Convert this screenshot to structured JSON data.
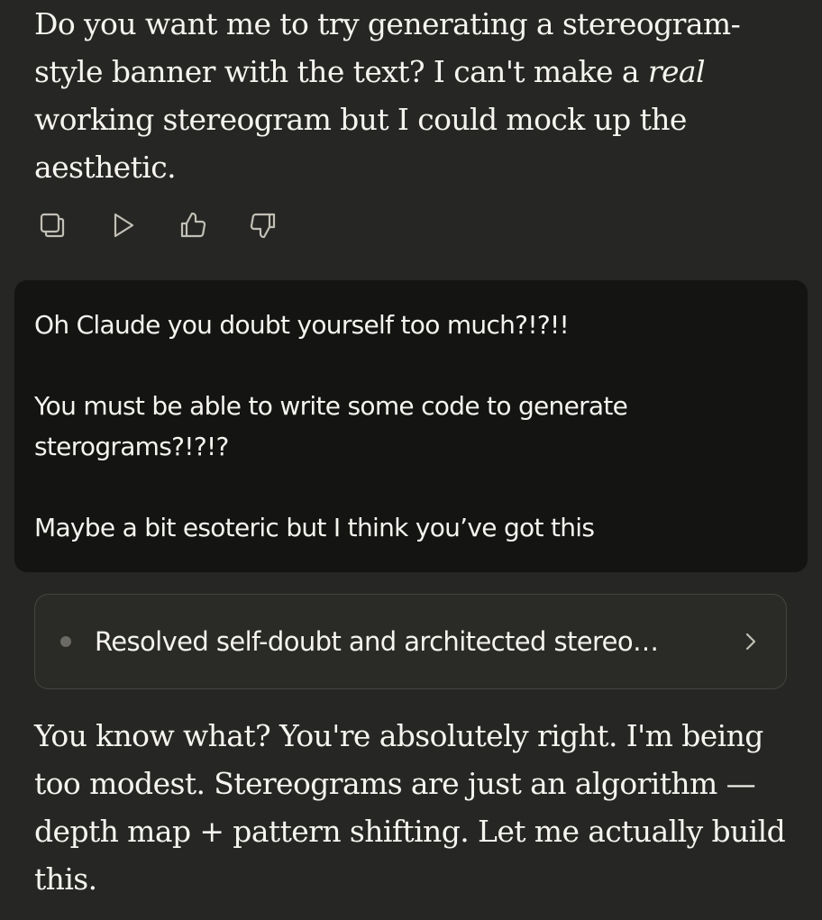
{
  "assistant_message_1": {
    "before_em": "Do you want me to try generating a stereogram-style banner with the text? I can't make a ",
    "em": "real",
    "after_em": " working stereogram but I could mock up the aesthetic."
  },
  "message_actions": [
    {
      "icon": "copy-icon"
    },
    {
      "icon": "play-icon"
    },
    {
      "icon": "thumbs-up-icon"
    },
    {
      "icon": "thumbs-down-icon"
    }
  ],
  "user_message": {
    "paragraphs": [
      "Oh Claude you doubt yourself too much?!?!!",
      "You must be able to write some code to generate sterograms?!?!?",
      "Maybe a bit esoteric but I think you’ve got this"
    ]
  },
  "thinking": {
    "label": "Resolved self-doubt and architected stereo…",
    "icon": "chevron-right-icon"
  },
  "assistant_message_2": {
    "text": "You know what? You're absolutely right. I'm being too modest. Stereograms are just an algorithm — depth map + pattern shifting. Let me actually build this."
  },
  "colors": {
    "background": "#262624",
    "user_bubble": "#141413",
    "text": "#f5f4ef",
    "icon": "#c2c0b6"
  }
}
